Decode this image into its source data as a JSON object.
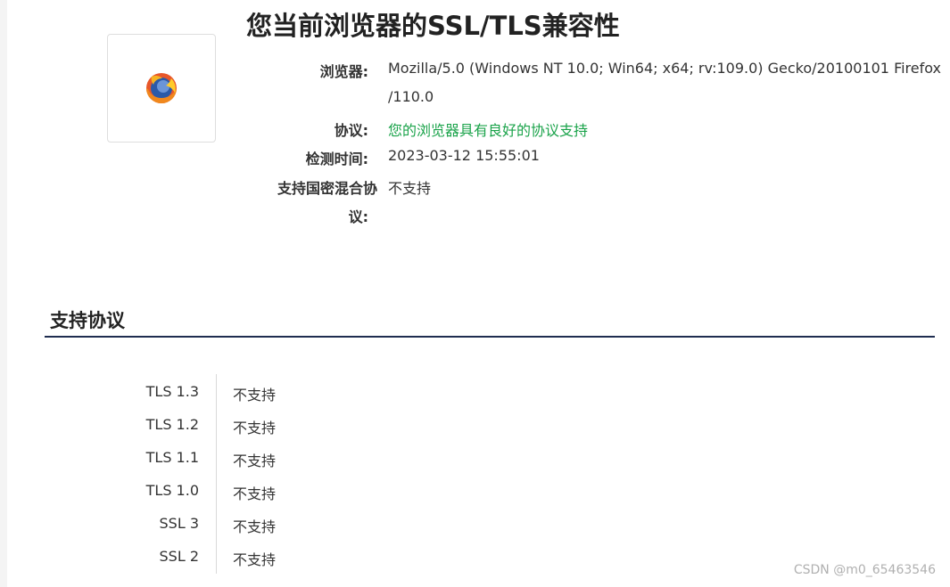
{
  "page": {
    "title": "您当前浏览器的SSL/TLS兼容性"
  },
  "logo": {
    "icon": "firefox-logo-icon"
  },
  "info": {
    "browser_label": "浏览器:",
    "browser_value_line1": "Mozilla/5.0 (Windows NT 10.0; Win64; x64; rv:109.0) Gecko/20100101 Firefox",
    "browser_value_line2": "/110.0",
    "protocol_label": "协议:",
    "protocol_value": "您的浏览器具有良好的协议支持",
    "protocol_value_color": "#1aa34a",
    "time_label": "检测时间:",
    "time_value": "2023-03-12 15:55:01",
    "mixed_label_line1": "支持国密混合协",
    "mixed_label_line2": "议:",
    "mixed_value": "不支持"
  },
  "protocols_section": {
    "title": "支持协议",
    "rule_color": "#1f2d50",
    "rows": [
      {
        "name": "TLS 1.3",
        "status": "不支持"
      },
      {
        "name": "TLS 1.2",
        "status": "不支持"
      },
      {
        "name": "TLS 1.1",
        "status": "不支持"
      },
      {
        "name": "TLS 1.0",
        "status": "不支持"
      },
      {
        "name": "SSL 3",
        "status": "不支持"
      },
      {
        "name": "SSL 2",
        "status": "不支持"
      }
    ]
  },
  "watermark": {
    "text": "CSDN @m0_65463546"
  }
}
